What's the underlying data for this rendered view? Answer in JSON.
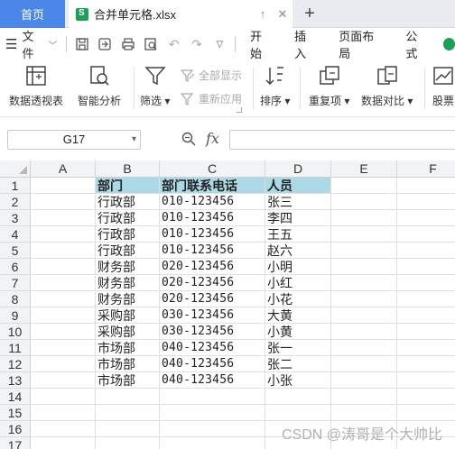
{
  "tabs": {
    "home": "首页",
    "file_name": "合并单元格.xlsx",
    "add": "+"
  },
  "menu": {
    "file_label": "文件",
    "tabs": [
      "开始",
      "插入",
      "页面布局",
      "公式"
    ]
  },
  "ribbon": {
    "pivot": "数据透视表",
    "smart": "智能分析",
    "filter": "筛选",
    "show_all": "全部显示",
    "reapply": "重新应用",
    "sort": "排序",
    "dup": "重复项",
    "compare": "数据对比",
    "stock": "股票"
  },
  "formula_bar": {
    "cell_ref": "G17",
    "fx": "fx",
    "value": ""
  },
  "columns": [
    "A",
    "B",
    "C",
    "D",
    "E",
    "F"
  ],
  "rows": [
    {
      "n": "1",
      "b": "部门",
      "c": "部门联系电话",
      "d": "人员"
    },
    {
      "n": "2",
      "b": "行政部",
      "c": "010-123456",
      "d": "张三"
    },
    {
      "n": "3",
      "b": "行政部",
      "c": "010-123456",
      "d": "李四"
    },
    {
      "n": "4",
      "b": "行政部",
      "c": "010-123456",
      "d": "王五"
    },
    {
      "n": "5",
      "b": "行政部",
      "c": "010-123456",
      "d": "赵六"
    },
    {
      "n": "6",
      "b": "财务部",
      "c": "020-123456",
      "d": "小明"
    },
    {
      "n": "7",
      "b": "财务部",
      "c": "020-123456",
      "d": "小红"
    },
    {
      "n": "8",
      "b": "财务部",
      "c": "020-123456",
      "d": "小花"
    },
    {
      "n": "9",
      "b": "采购部",
      "c": "030-123456",
      "d": "大黄"
    },
    {
      "n": "10",
      "b": "采购部",
      "c": "030-123456",
      "d": "小黄"
    },
    {
      "n": "11",
      "b": "市场部",
      "c": "040-123456",
      "d": "张一"
    },
    {
      "n": "12",
      "b": "市场部",
      "c": "040-123456",
      "d": "张二"
    },
    {
      "n": "13",
      "b": "市场部",
      "c": "040-123456",
      "d": "小张"
    },
    {
      "n": "14",
      "b": "",
      "c": "",
      "d": ""
    },
    {
      "n": "15",
      "b": "",
      "c": "",
      "d": ""
    },
    {
      "n": "16",
      "b": "",
      "c": "",
      "d": ""
    },
    {
      "n": "17",
      "b": "",
      "c": "",
      "d": ""
    }
  ],
  "watermark": "CSDN @涛哥是个大帅比",
  "colors": {
    "header_fill": "#add8e6",
    "home_tab": "#4a87e8",
    "brand_green": "#1d9f57"
  }
}
